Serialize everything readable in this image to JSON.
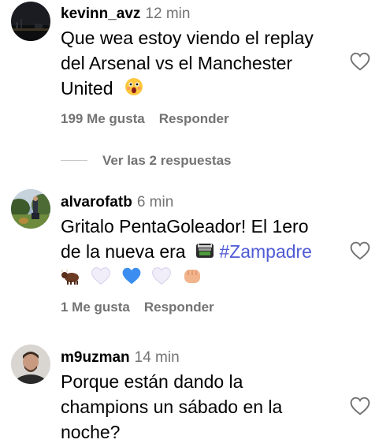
{
  "comments": [
    {
      "username": "kevinn_avz",
      "time": "12 min",
      "text_line1": "Que wea estoy viendo el replay",
      "text_line2": "del Arsenal vs el Manchester",
      "text_line3": "United",
      "likes": "199 Me gusta",
      "reply_label": "Responder",
      "avatar": "dark-night-photo",
      "emoji": "astonished-face-emoji"
    },
    {
      "username": "alvarofatb",
      "time": "6 min",
      "text_line1": "Gritalo PentaGoleador! El 1ero",
      "text_line2": "de la nueva era",
      "hashtag": "#Zampadre",
      "reactions": [
        "ox-emoji",
        "white-heart-emoji",
        "blue-heart-emoji",
        "white-heart-emoji",
        "fist-emoji"
      ],
      "likes": "1 Me gusta",
      "reply_label": "Responder",
      "avatar": "outdoor-photo",
      "emoji": "stadium-emoji"
    },
    {
      "username": "m9uzman",
      "time": "14 min",
      "text_line1": "Porque están dando la",
      "text_line2": "champions un sábado en la",
      "text_line3": "noche?",
      "avatar": "portrait-photo"
    }
  ],
  "view_replies": "Ver las 2 respuestas",
  "colors": {
    "secondary_text": "#737373",
    "hashtag": "#4f5bd5",
    "divider": "#c7c7c7"
  },
  "icons": [
    "heart-outline-icon"
  ]
}
